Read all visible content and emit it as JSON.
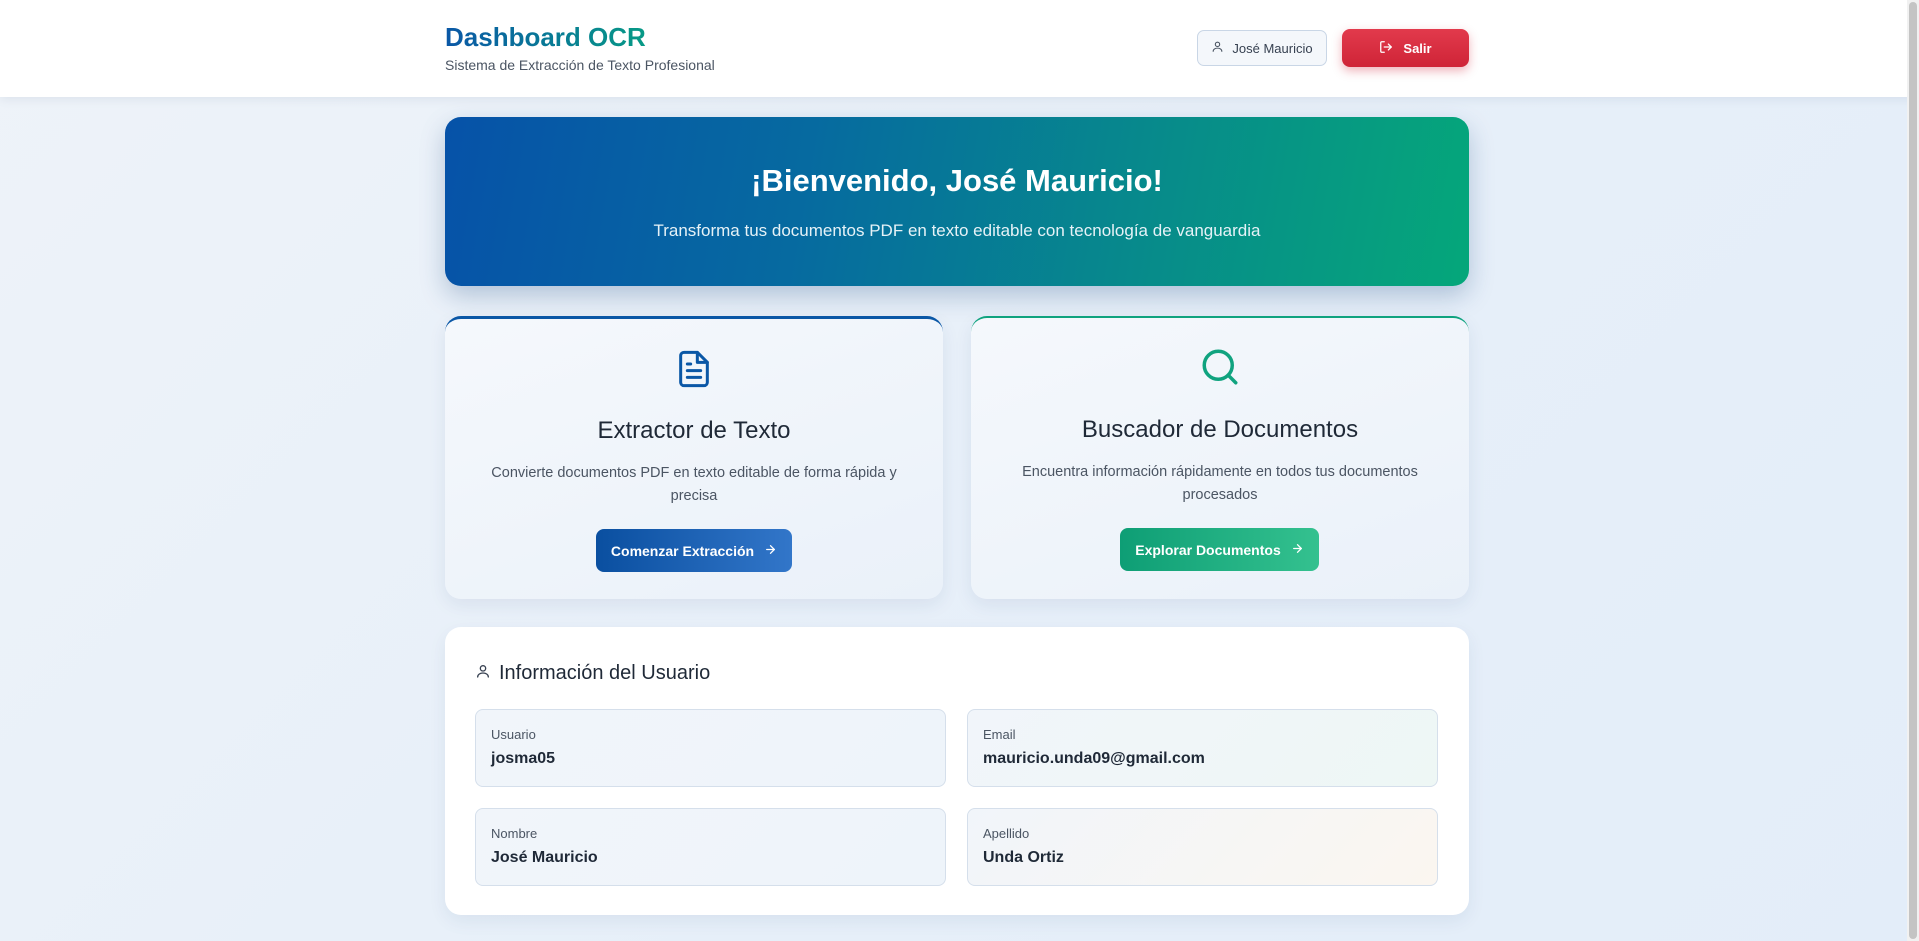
{
  "header": {
    "title": "Dashboard OCR",
    "subtitle": "Sistema de Extracción de Texto Profesional",
    "user_name": "José Mauricio",
    "logout_label": "Salir"
  },
  "hero": {
    "title": "¡Bienvenido, José Mauricio!",
    "subtitle": "Transforma tus documentos PDF en texto editable con tecnología de vanguardia"
  },
  "cards": [
    {
      "icon": "document-icon",
      "title": "Extractor de Texto",
      "description": "Convierte documentos PDF en texto editable de forma rápida y precisa",
      "button_label": "Comenzar Extracción",
      "accent": "#0a57a6"
    },
    {
      "icon": "search-icon",
      "title": "Buscador de Documentos",
      "description": "Encuentra información rápidamente en todos tus documentos procesados",
      "button_label": "Explorar Documentos",
      "accent": "#10a37f"
    }
  ],
  "user_info": {
    "title": "Información del Usuario",
    "fields": [
      {
        "label": "Usuario",
        "value": "josma05"
      },
      {
        "label": "Email",
        "value": "mauricio.unda09@gmail.com"
      },
      {
        "label": "Nombre",
        "value": "José Mauricio"
      },
      {
        "label": "Apellido",
        "value": "Unda Ortiz"
      }
    ]
  },
  "colors": {
    "primary": "#0a57a6",
    "secondary": "#10a37f",
    "danger": "#d62c3f"
  }
}
